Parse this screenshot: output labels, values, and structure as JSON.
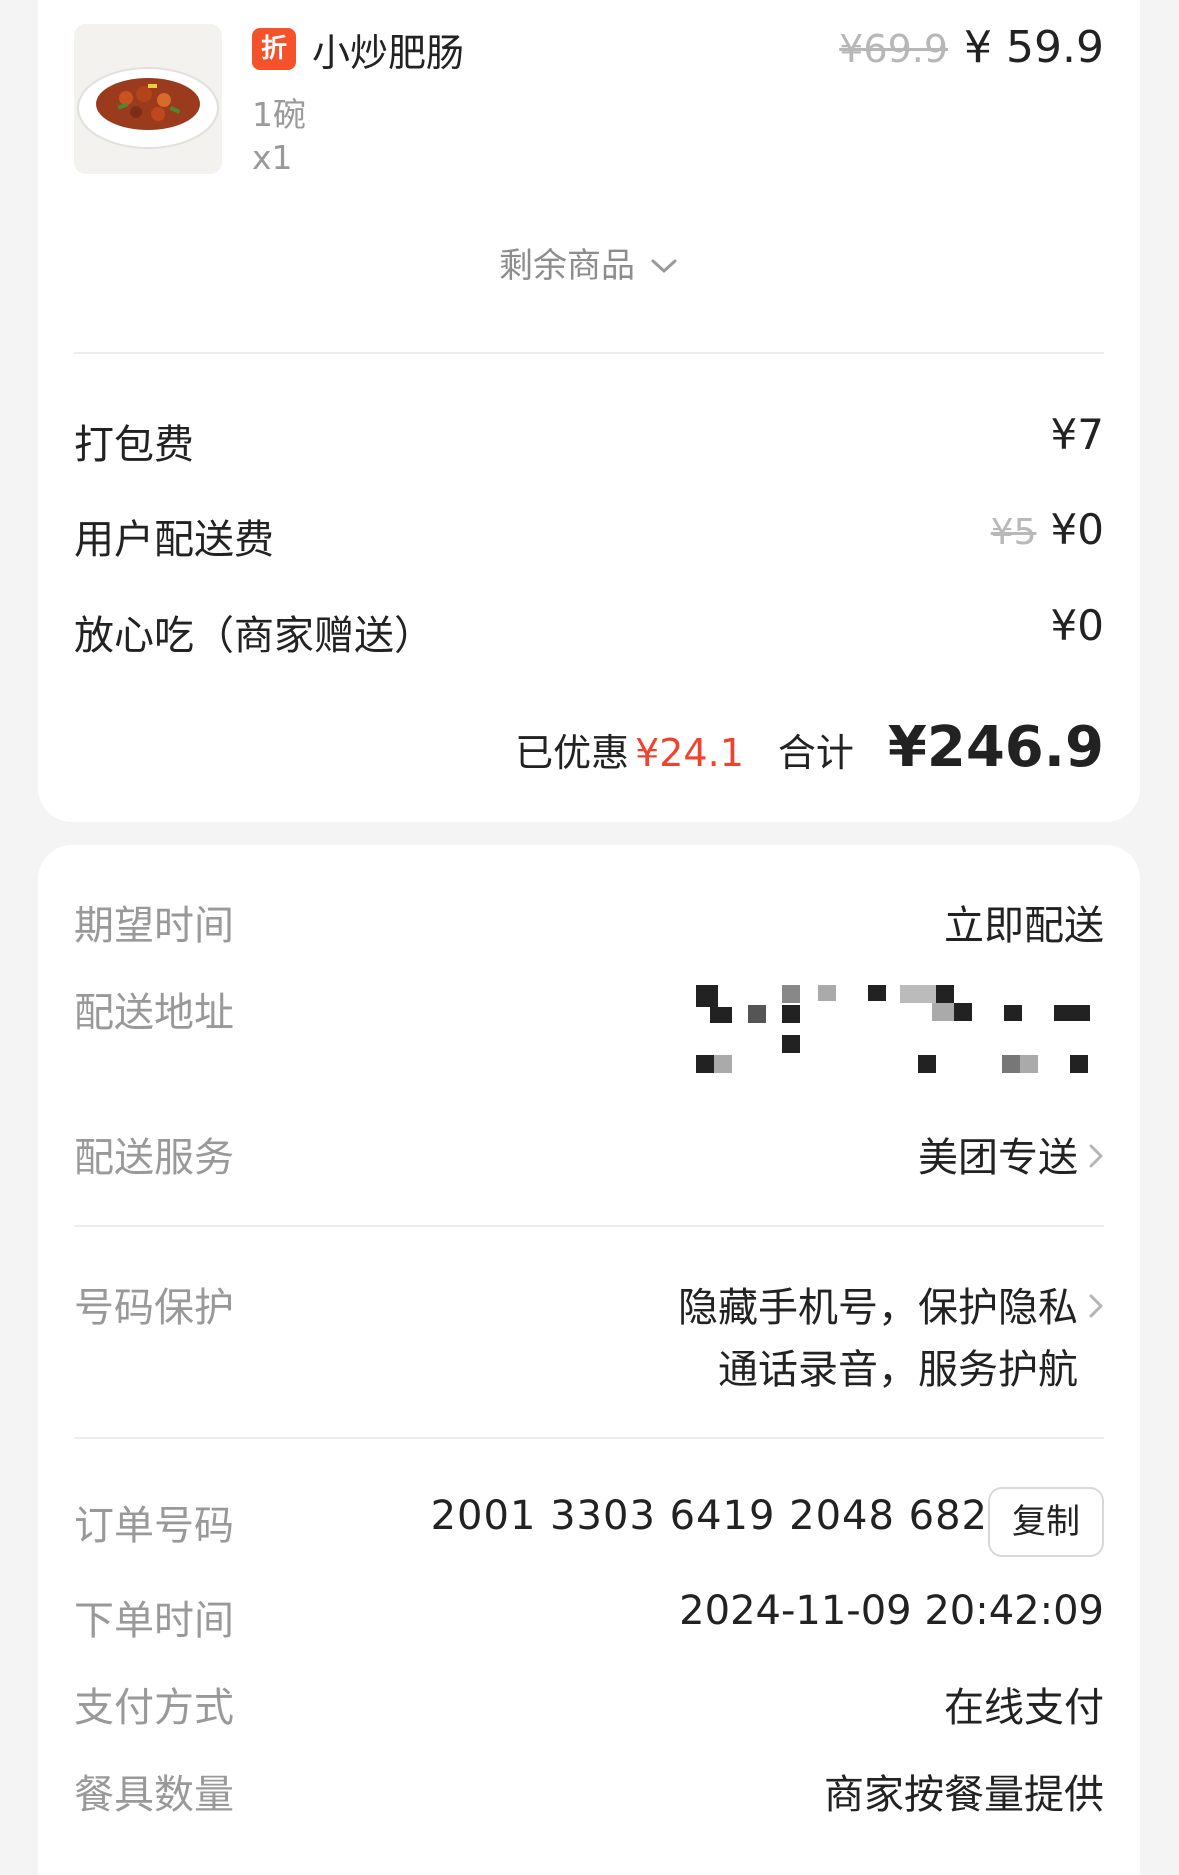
{
  "product": {
    "badge": "折",
    "name": "小炒肥肠",
    "spec": "1碗",
    "quantity": "x1",
    "original_price": "¥69.9",
    "price": "¥ 59.9",
    "image_icon": "dish-photo"
  },
  "remaining_items": {
    "label": "剩余商品",
    "icon": "chevron-down-icon"
  },
  "fees": {
    "packaging": {
      "label": "打包费",
      "value": "¥7"
    },
    "delivery": {
      "label": "用户配送费",
      "original": "¥5",
      "value": "¥0"
    },
    "assurance": {
      "label": "放心吃（商家赠送）",
      "value": "¥0"
    }
  },
  "summary": {
    "discount_label": "已优惠",
    "discount_value": "¥24.1",
    "total_label": "合计",
    "total_value": "¥246.9"
  },
  "delivery_info": {
    "expected_time": {
      "label": "期望时间",
      "value": "立即配送"
    },
    "address": {
      "label": "配送地址",
      "value": ""
    },
    "service": {
      "label": "配送服务",
      "value": "美团专送"
    }
  },
  "privacy": {
    "label": "号码保护",
    "line1": "隐藏手机号，保护隐私",
    "line2": "通话录音，服务护航"
  },
  "order": {
    "number_label": "订单号码",
    "number_value": "2001 3303 6419 2048 682",
    "copy_label": "复制",
    "time_label": "下单时间",
    "time_value": "2024-11-09 20:42:09",
    "payment_label": "支付方式",
    "payment_value": "在线支付",
    "tableware_label": "餐具数量",
    "tableware_value": "商家按餐量提供"
  },
  "colors": {
    "badge": "#f5522c",
    "discount": "#f0432f",
    "page_background": "#f4f4f4"
  }
}
